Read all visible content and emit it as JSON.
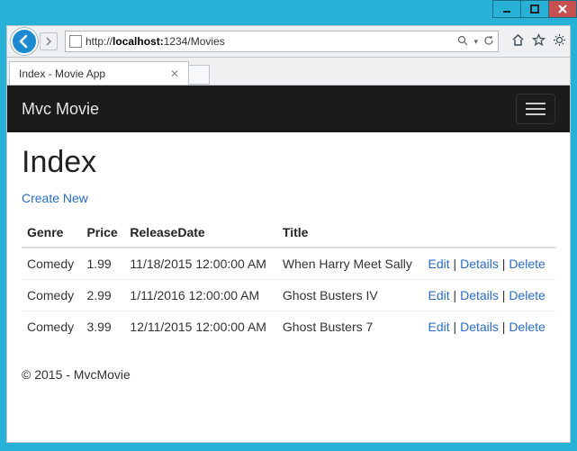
{
  "window": {
    "tab_title": "Index - Movie App"
  },
  "address": {
    "prefix": "http://",
    "host": "localhost:",
    "port_path": "1234/Movies"
  },
  "nav": {
    "brand": "Mvc Movie"
  },
  "page": {
    "heading": "Index",
    "create_link": "Create New",
    "columns": {
      "genre": "Genre",
      "price": "Price",
      "release": "ReleaseDate",
      "title": "Title"
    },
    "actions": {
      "edit": "Edit",
      "details": "Details",
      "delete": "Delete",
      "sep": " | "
    },
    "rows": [
      {
        "genre": "Comedy",
        "price": "1.99",
        "release": "11/18/2015 12:00:00 AM",
        "title": "When Harry Meet Sally"
      },
      {
        "genre": "Comedy",
        "price": "2.99",
        "release": "1/11/2016 12:00:00 AM",
        "title": "Ghost Busters IV"
      },
      {
        "genre": "Comedy",
        "price": "3.99",
        "release": "12/11/2015 12:00:00 AM",
        "title": "Ghost Busters 7"
      }
    ],
    "footer": "© 2015 - MvcMovie"
  }
}
